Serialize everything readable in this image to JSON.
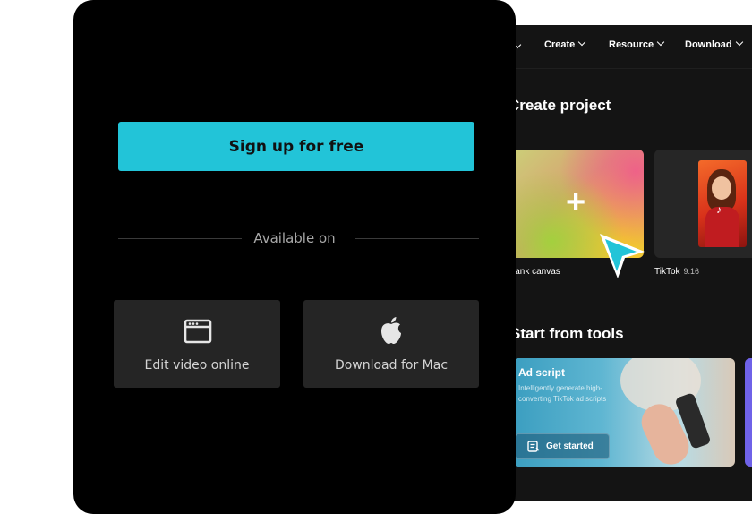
{
  "nav": {
    "items": [
      {
        "label": "Create"
      },
      {
        "label": "Resource"
      },
      {
        "label": "Download"
      }
    ]
  },
  "create_project": {
    "title": "Create project",
    "blank_canvas_label": "lank canvas",
    "tiktok_label": "TikTok",
    "tiktok_ratio": "9:16"
  },
  "tools": {
    "title": "Start from tools",
    "ad_card": {
      "title": "Ad script",
      "description": "Intelligently generate high-converting TikTok ad scripts",
      "button_label": "Get started"
    }
  },
  "modal": {
    "signup_label": "Sign up for free",
    "available_label": "Available on",
    "options": [
      {
        "label": "Edit video online",
        "icon": "browser-window-icon"
      },
      {
        "label": "Download for Mac",
        "icon": "apple-icon"
      }
    ]
  },
  "colors": {
    "accent": "#22c4d8",
    "panel_bg": "#000000",
    "app_bg": "#141414",
    "option_bg": "#252525"
  }
}
